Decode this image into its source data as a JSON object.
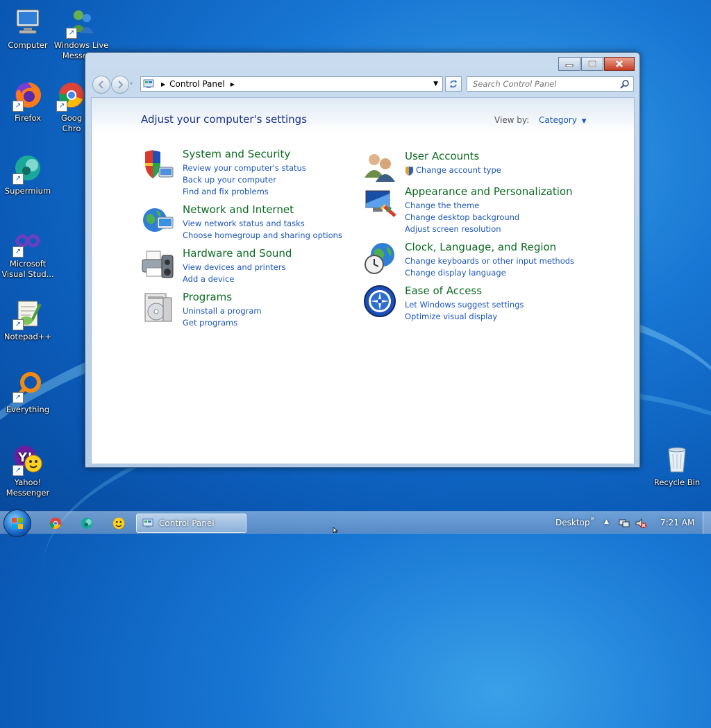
{
  "desktop": {
    "icons": [
      {
        "label1": "Computer",
        "label2": ""
      },
      {
        "label1": "Windows Live",
        "label2": "Messen..."
      },
      {
        "label1": "Firefox",
        "label2": ""
      },
      {
        "label1": "Goog",
        "label2": "Chro"
      },
      {
        "label1": "Supermium",
        "label2": ""
      },
      {
        "label1": "Microsoft",
        "label2": "Visual Stud..."
      },
      {
        "label1": "Notepad++",
        "label2": ""
      },
      {
        "label1": "Everything",
        "label2": ""
      },
      {
        "label1": "Yahoo!",
        "label2": "Messenger"
      },
      {
        "label1": "Recycle Bin",
        "label2": ""
      }
    ]
  },
  "window": {
    "breadcrumb": "Control Panel",
    "search_placeholder": "Search Control Panel",
    "heading": "Adjust your computer's settings",
    "view_by_label": "View by:",
    "view_by_value": "Category",
    "categories": [
      {
        "title": "System and Security",
        "links": [
          "Review your computer's status",
          "Back up your computer",
          "Find and fix problems"
        ]
      },
      {
        "title": "Network and Internet",
        "links": [
          "View network status and tasks",
          "Choose homegroup and sharing options"
        ]
      },
      {
        "title": "Hardware and Sound",
        "links": [
          "View devices and printers",
          "Add a device"
        ]
      },
      {
        "title": "Programs",
        "links": [
          "Uninstall a program",
          "Get programs"
        ]
      },
      {
        "title": "User Accounts",
        "links": [
          "Change account type"
        ]
      },
      {
        "title": "Appearance and Personalization",
        "links": [
          "Change the theme",
          "Change desktop background",
          "Adjust screen resolution"
        ]
      },
      {
        "title": "Clock, Language, and Region",
        "links": [
          "Change keyboards or other input methods",
          "Change display language"
        ]
      },
      {
        "title": "Ease of Access",
        "links": [
          "Let Windows suggest settings",
          "Optimize visual display"
        ]
      }
    ]
  },
  "taskbar": {
    "task_label": "Control Panel",
    "desktop_label": "Desktop",
    "clock": "7:21 AM"
  },
  "colors": {
    "category_title": "#0d6b22",
    "link": "#1b56b8",
    "heading": "#1e3287"
  }
}
